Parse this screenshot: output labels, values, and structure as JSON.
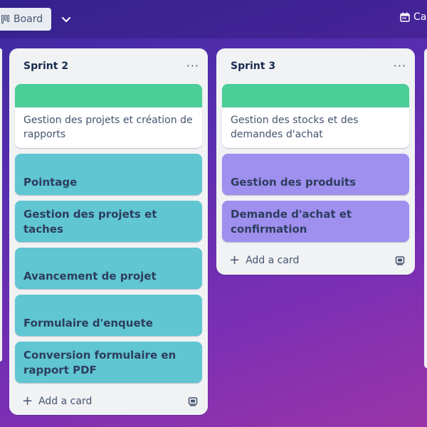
{
  "header": {
    "view_label": "Board",
    "calendar_label": "Ca"
  },
  "lists": [
    {
      "title": "Sprint 2",
      "menu": "···",
      "cover_card": "Gestion des projets et création de rapports",
      "cards": [
        "Pointage",
        "Gestion des projets et taches",
        "Avancement de projet",
        "Formulaire d'enquete",
        "Conversion formulaire en rapport PDF"
      ],
      "add_card": "Add a card"
    },
    {
      "title": "Sprint 3",
      "menu": "···",
      "cover_card": "Gestion des stocks et des demandes d'achat",
      "cards": [
        "Gestion des produits",
        "Demande d'achat et confirmation"
      ],
      "add_card": "Add a card"
    }
  ],
  "colors": {
    "cover_green": "#4bce97",
    "card_teal": "#60c6d2",
    "card_purple": "#9f8fef",
    "list_bg": "#f1f2f4"
  },
  "icons": {
    "view": "board-icon",
    "view_dropdown": "chevron-down-icon",
    "calendar": "calendar-icon",
    "list_menu": "more-icon",
    "add": "plus-icon",
    "template": "card-template-icon"
  }
}
